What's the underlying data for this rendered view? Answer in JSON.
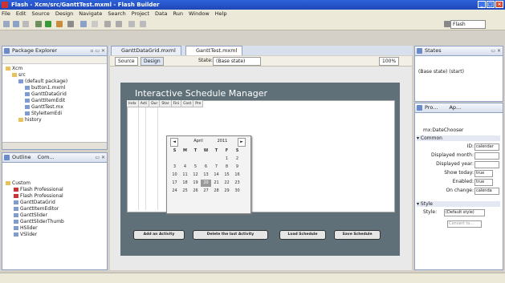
{
  "window": {
    "title": "Flash - Xcm/src/GanttTest.mxml - Flash Builder"
  },
  "menu": [
    "File",
    "Edit",
    "Source",
    "Design",
    "Navigate",
    "Search",
    "Project",
    "Data",
    "Run",
    "Window",
    "Help"
  ],
  "toolbar": {
    "perspective": "Flash"
  },
  "package_explorer": {
    "tab_label": "Package Explorer",
    "tree": [
      "Xcm",
      "src",
      "(default package)",
      "button1.mxml",
      "GanttDataGrid",
      "GanttItemEdit",
      "GanttTest.mx",
      "StyleItemEdi",
      "history"
    ]
  },
  "outline": {
    "tab1": "Outline",
    "tab2": "Com...",
    "tree": [
      "Custom",
      "Flash Professional",
      "Flash Professional",
      "GanttDataGrid",
      "GanttItemEditor",
      "GanttSlider",
      "GanttSliderThumb",
      "HSlider",
      "VSlider"
    ]
  },
  "editor": {
    "tabs": [
      "GanttDataGrid.mxml",
      "GanttTest.mxml"
    ],
    "source_label": "Source",
    "design_label": "Design",
    "state_label": "State:",
    "state_value": "(Base state)",
    "zoom": "100%"
  },
  "app": {
    "title": "Interactive Schedule Manager",
    "grid_headers": [
      "Indx",
      "Acti",
      "Dur",
      "Star",
      "Fini",
      "Cost",
      "Pre"
    ],
    "calendar": {
      "month": "April",
      "year": "2011",
      "prev": "◄",
      "next": "►",
      "daynames": [
        "S",
        "M",
        "T",
        "W",
        "T",
        "F",
        "S"
      ],
      "days": [
        "",
        "",
        "",
        "",
        "",
        "1",
        "2",
        "3",
        "4",
        "5",
        "6",
        "7",
        "8",
        "9",
        "10",
        "11",
        "12",
        "13",
        "14",
        "15",
        "16",
        "17",
        "18",
        "19",
        "20",
        "21",
        "22",
        "23",
        "24",
        "25",
        "26",
        "27",
        "28",
        "29",
        "30",
        "",
        ""
      ],
      "selected": "20"
    },
    "buttons": [
      "Add an Activity",
      "Delete the last Activity",
      "Load Schedule",
      "Save Schedule"
    ]
  },
  "states": {
    "tab_label": "States",
    "entry": "(Base state) (start)"
  },
  "properties": {
    "tab1": "Pro...",
    "tab2": "Ap...",
    "component": "mx:DateChooser",
    "section_common": "Common",
    "rows": [
      {
        "label": "ID:",
        "value": "calendar"
      },
      {
        "label": "Displayed month:",
        "value": ""
      },
      {
        "label": "Displayed year:",
        "value": ""
      },
      {
        "label": "Show today:",
        "value": "true"
      },
      {
        "label": "Enabled:",
        "value": "true"
      },
      {
        "label": "On change:",
        "value": "calenda"
      }
    ],
    "section_style": "Style",
    "style_label": "Style:",
    "style_value": "(Default style)",
    "convert_label": "Convert to..."
  }
}
